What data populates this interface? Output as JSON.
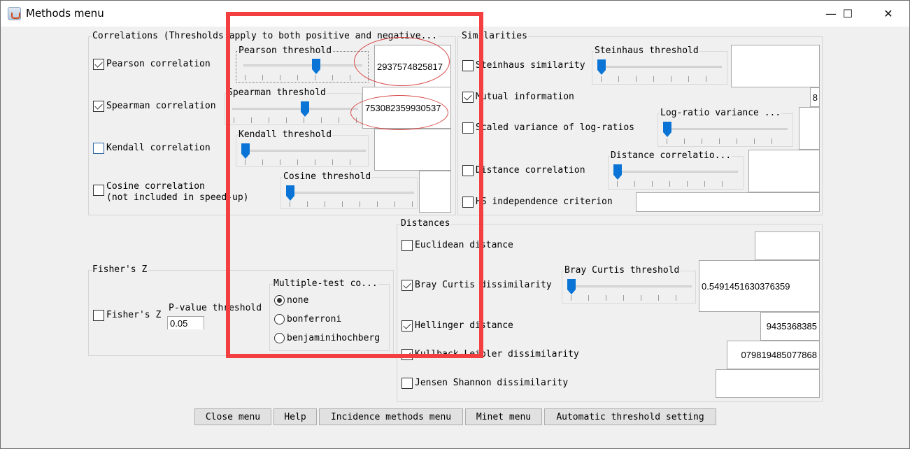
{
  "window": {
    "title": "Methods menu",
    "controls": {
      "minimize": "—",
      "maximize": "☐",
      "close": "✕"
    }
  },
  "correlations": {
    "title": "Correlations (Thresholds apply to both positive and negative...",
    "items": [
      {
        "label": "Pearson correlation",
        "checked": true,
        "threshold_label": "Pearson threshold",
        "slider_value": 0.6,
        "threshold_value": "2937574825817"
      },
      {
        "label": "Spearman correlation",
        "checked": true,
        "threshold_label": "Spearman threshold",
        "slider_value": 0.6,
        "threshold_value": "753082359930537"
      },
      {
        "label": "Kendall correlation",
        "checked": false,
        "threshold_label": "Kendall threshold",
        "slider_value": 0,
        "threshold_value": ""
      },
      {
        "label": "Cosine correlation",
        "label2": "(not included in speed-up)",
        "checked": false,
        "threshold_label": "Cosine threshold",
        "slider_value": 0,
        "threshold_value": ""
      }
    ]
  },
  "similarities": {
    "title": "Similarities",
    "items": [
      {
        "label": "Steinhaus similarity",
        "checked": false,
        "threshold_label": "Steinhaus threshold",
        "slider_value": 0,
        "threshold_value": ""
      },
      {
        "label": "Mutual information",
        "checked": true,
        "threshold_value": "8"
      },
      {
        "label": "Scaled variance of log-ratios",
        "checked": false,
        "threshold_label": "Log-ratio variance ...",
        "slider_value": 0,
        "threshold_value": ""
      },
      {
        "label": "Distance correlation",
        "checked": false,
        "threshold_label": "Distance correlatio...",
        "slider_value": 0,
        "threshold_value": ""
      },
      {
        "label": "HS independence criterion",
        "checked": false,
        "threshold_value": ""
      }
    ]
  },
  "distances": {
    "title": "Distances",
    "items": [
      {
        "label": "Euclidean distance",
        "checked": false,
        "threshold_value": ""
      },
      {
        "label": "Bray Curtis dissimilarity",
        "checked": true,
        "threshold_label": "Bray Curtis threshold",
        "slider_value": 0,
        "threshold_value": "0.5491451630376359"
      },
      {
        "label": "Hellinger distance",
        "checked": true,
        "threshold_value": "9435368385"
      },
      {
        "label": "Kullback-Leibler dissimilarity",
        "checked": true,
        "threshold_value": "079819485077868"
      },
      {
        "label": "Jensen Shannon dissimilarity",
        "checked": false,
        "threshold_value": ""
      }
    ]
  },
  "fishers_z": {
    "title": "Fisher's Z",
    "checkbox_label": "Fisher's Z",
    "checked": false,
    "pvalue_label": "P-value threshold",
    "pvalue": "0.05",
    "multiple_test": {
      "title": "Multiple-test co...",
      "options": [
        "none",
        "bonferroni",
        "benjaminihochberg"
      ],
      "selected": "none"
    }
  },
  "buttons": {
    "close": "Close menu",
    "help": "Help",
    "incidence": "Incidence methods menu",
    "minet": "Minet menu",
    "auto_threshold": "Automatic threshold setting"
  },
  "annotation_colors": {
    "highlight": "#f33f3f"
  }
}
